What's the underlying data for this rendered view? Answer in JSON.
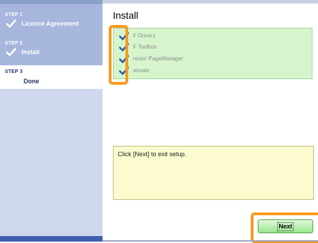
{
  "sidebar": {
    "steps": [
      {
        "number": "STEP 1",
        "label": "Licence Agreement",
        "icon": "checkmark-icon",
        "state": "done"
      },
      {
        "number": "STEP 2",
        "label": "Install",
        "icon": "checkmark-icon",
        "state": "done"
      },
      {
        "number": "STEP 3",
        "label": "Done",
        "state": "current"
      }
    ]
  },
  "main": {
    "title": "Install",
    "components": [
      {
        "label": "F Drivers",
        "icon": "checkmark-icon"
      },
      {
        "label": "F Toolbox",
        "icon": "checkmark-icon"
      },
      {
        "label": "resto! PageManager",
        "icon": "checkmark-icon"
      },
      {
        "label": "anuals",
        "icon": "checkmark-icon"
      }
    ],
    "message": "Click [Next] to exit setup.",
    "next_label": "Next"
  },
  "colors": {
    "highlight": "#f79a1e",
    "list_background": "#d6f5cc",
    "message_background": "#fbfbcf",
    "sidebar_background": "#cfd8ef",
    "check_color": "#2f5aa8"
  }
}
